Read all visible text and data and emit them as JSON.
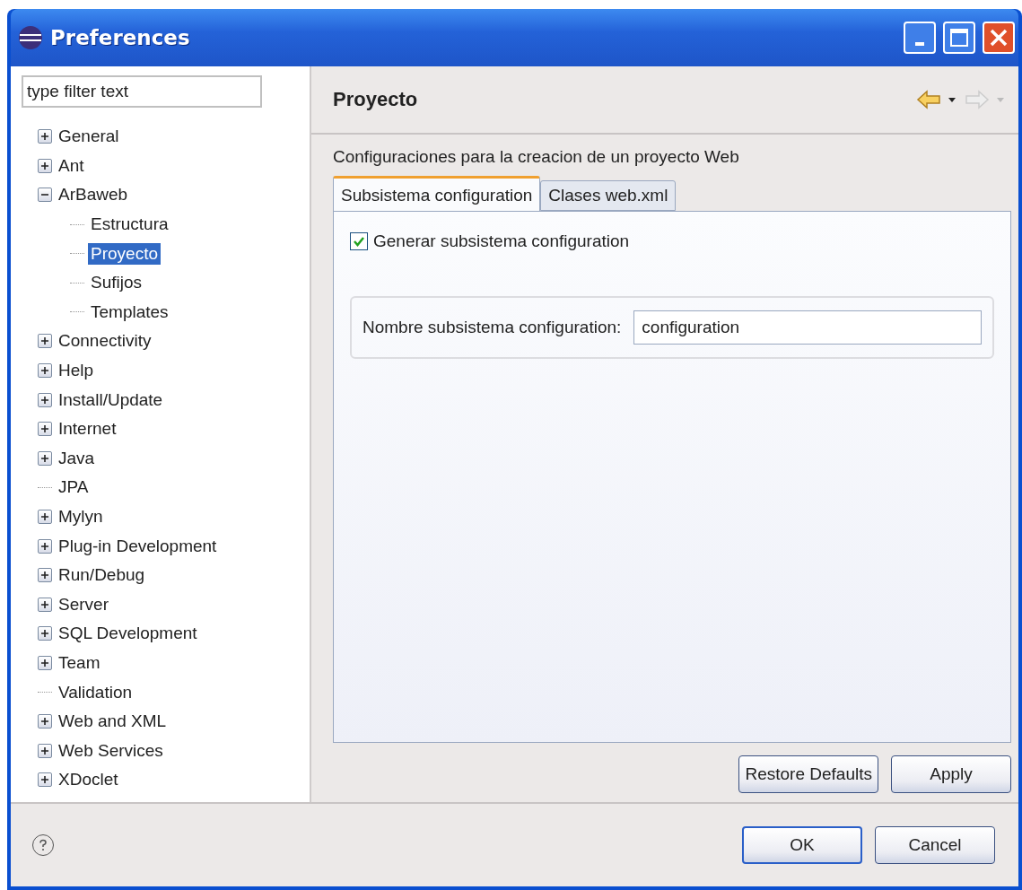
{
  "window": {
    "title": "Preferences"
  },
  "filter": {
    "placeholder": "type filter text"
  },
  "tree": [
    {
      "label": "General",
      "expanded": false,
      "selected": false
    },
    {
      "label": "Ant",
      "expanded": false,
      "selected": false
    },
    {
      "label": "ArBaweb",
      "expanded": true,
      "selected": false,
      "children": [
        {
          "label": "Estructura",
          "selected": false
        },
        {
          "label": "Proyecto",
          "selected": true
        },
        {
          "label": "Sufijos",
          "selected": false
        },
        {
          "label": "Templates",
          "selected": false
        }
      ]
    },
    {
      "label": "Connectivity",
      "expanded": false,
      "selected": false
    },
    {
      "label": "Help",
      "expanded": false,
      "selected": false
    },
    {
      "label": "Install/Update",
      "expanded": false,
      "selected": false
    },
    {
      "label": "Internet",
      "expanded": false,
      "selected": false
    },
    {
      "label": "Java",
      "expanded": false,
      "selected": false
    },
    {
      "label": "JPA",
      "selected": false
    },
    {
      "label": "Mylyn",
      "expanded": false,
      "selected": false
    },
    {
      "label": "Plug-in Development",
      "expanded": false,
      "selected": false
    },
    {
      "label": "Run/Debug",
      "expanded": false,
      "selected": false
    },
    {
      "label": "Server",
      "expanded": false,
      "selected": false
    },
    {
      "label": "SQL Development",
      "expanded": false,
      "selected": false
    },
    {
      "label": "Team",
      "expanded": false,
      "selected": false
    },
    {
      "label": "Validation",
      "selected": false
    },
    {
      "label": "Web and XML",
      "expanded": false,
      "selected": false
    },
    {
      "label": "Web Services",
      "expanded": false,
      "selected": false
    },
    {
      "label": "XDoclet",
      "expanded": false,
      "selected": false
    }
  ],
  "page": {
    "title": "Proyecto",
    "description": "Configuraciones para la creacion de un proyecto Web",
    "tabs": [
      {
        "label": "Subsistema configuration",
        "selected": true
      },
      {
        "label": "Clases web.xml",
        "selected": false
      }
    ],
    "checkbox": {
      "label": "Generar subsistema configuration",
      "checked": true
    },
    "field": {
      "label": "Nombre subsistema configuration:",
      "value": "configuration"
    },
    "buttons": [
      "Restore Defaults",
      "Apply"
    ]
  },
  "footer_buttons": [
    {
      "label": "OK",
      "default": true
    },
    {
      "label": "Cancel",
      "default": false
    }
  ]
}
